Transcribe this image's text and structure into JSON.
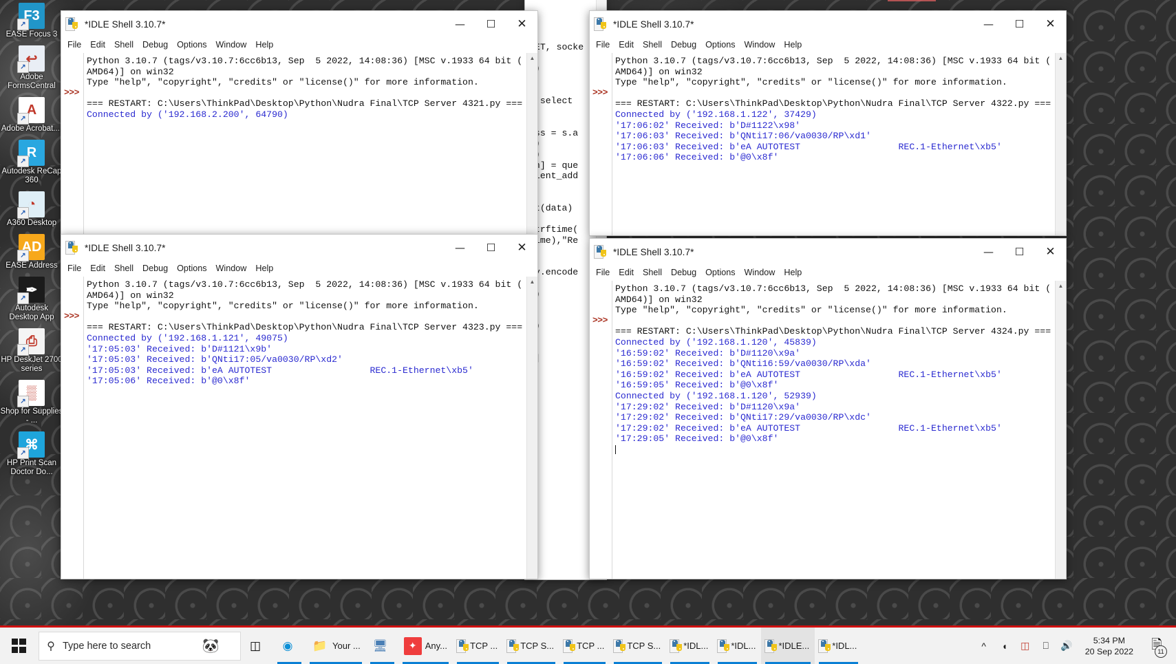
{
  "desktop": {
    "icons": [
      {
        "name": "EASE Focus 3",
        "label": "EASE Focus 3",
        "glyph": "F3",
        "bg": "#2196c9"
      },
      {
        "name": "Adobe FormsCentral",
        "label": "Adobe FormsCentral",
        "glyph": "↩",
        "bg": "#e9eef5"
      },
      {
        "name": "Adobe Acrobat",
        "label": "Adobe Acrobat....",
        "glyph": "A",
        "bg": "#ffffff"
      },
      {
        "name": "Autodesk ReCap 360",
        "label": "Autodesk ReCap 360",
        "glyph": "R",
        "bg": "#29a7e0"
      },
      {
        "name": "A360 Desktop",
        "label": "A360 Desktop",
        "glyph": "◔",
        "bg": "#dfeff7"
      },
      {
        "name": "EASE Address",
        "label": "EASE Address",
        "glyph": "AD",
        "bg": "#f7a81b"
      },
      {
        "name": "Autodesk Desktop App",
        "label": "Autodesk Desktop App",
        "glyph": "✒",
        "bg": "#1b1b1b"
      },
      {
        "name": "HP DeskJet 2700 series",
        "label": "HP DeskJet 2700 series",
        "glyph": "⎙",
        "bg": "#f4f4f4"
      },
      {
        "name": "Shop for Supplies",
        "label": "Shop for Supplies - ...",
        "glyph": "▒",
        "bg": "#ffffff"
      },
      {
        "name": "HP Print Scan Doctor",
        "label": "HP Print Scan Doctor Do...",
        "glyph": "⌘",
        "bg": "#1ea5dc"
      }
    ]
  },
  "window_common": {
    "title": "*IDLE Shell 3.10.7*",
    "icon": "python-file-icon",
    "menu": [
      "File",
      "Edit",
      "Shell",
      "Debug",
      "Options",
      "Window",
      "Help"
    ],
    "minimize": "—",
    "maximize": "☐",
    "close": "✕",
    "prompt": ">>>",
    "banner_line1": "Python 3.10.7 (tags/v3.10.7:6cc6b13, Sep  5 2022, 14:08:36) [MSC v.1933 64 bit (",
    "banner_line2": "AMD64)] on win32",
    "banner_line3": "Type \"help\", \"copyright\", \"credits\" or \"license()\" for more information."
  },
  "windows": [
    {
      "id": "shell-4321",
      "restart": "=== RESTART: C:\\Users\\ThinkPad\\Desktop\\Python\\Nudra Final\\TCP Server 4321.py ===",
      "lines": [
        {
          "text": "Connected by ('192.168.2.200', 64790)",
          "color": "blue"
        }
      ]
    },
    {
      "id": "shell-4322",
      "restart": "=== RESTART: C:\\Users\\ThinkPad\\Desktop\\Python\\Nudra Final\\TCP Server 4322.py ===",
      "lines": [
        {
          "text": "Connected by ('192.168.1.122', 37429)",
          "color": "blue"
        },
        {
          "text": "'17:06:02' Received: b'D#1122\\x98'",
          "color": "blue"
        },
        {
          "text": "'17:06:03' Received: b'QNti17:06/va0030/RP\\xd1'",
          "color": "blue"
        },
        {
          "text": "'17:06:03' Received: b'eA AUTOTEST                  REC.1-Ethernet\\xb5'",
          "color": "blue"
        },
        {
          "text": "'17:06:06' Received: b'@0\\x8f'",
          "color": "blue"
        }
      ]
    },
    {
      "id": "shell-4323",
      "restart": "=== RESTART: C:\\Users\\ThinkPad\\Desktop\\Python\\Nudra Final\\TCP Server 4323.py ===",
      "lines": [
        {
          "text": "Connected by ('192.168.1.121', 49075)",
          "color": "blue"
        },
        {
          "text": "'17:05:03' Received: b'D#1121\\x9b'",
          "color": "blue"
        },
        {
          "text": "'17:05:03' Received: b'QNti17:05/va0030/RP\\xd2'",
          "color": "blue"
        },
        {
          "text": "'17:05:03' Received: b'eA AUTOTEST                  REC.1-Ethernet\\xb5'",
          "color": "blue"
        },
        {
          "text": "'17:05:06' Received: b'@0\\x8f'",
          "color": "blue"
        }
      ]
    },
    {
      "id": "shell-4324",
      "restart": "=== RESTART: C:\\Users\\ThinkPad\\Desktop\\Python\\Nudra Final\\TCP Server 4324.py ===",
      "lines": [
        {
          "text": "Connected by ('192.168.1.120', 45839)",
          "color": "blue"
        },
        {
          "text": "'16:59:02' Received: b'D#1120\\x9a'",
          "color": "blue"
        },
        {
          "text": "'16:59:02' Received: b'QNti16:59/va0030/RP\\xda'",
          "color": "blue"
        },
        {
          "text": "'16:59:02' Received: b'eA AUTOTEST                  REC.1-Ethernet\\xb5'",
          "color": "blue"
        },
        {
          "text": "'16:59:05' Received: b'@0\\x8f'",
          "color": "blue"
        },
        {
          "text": "Connected by ('192.168.1.120', 52939)",
          "color": "blue"
        },
        {
          "text": "'17:29:02' Received: b'D#1120\\x9a'",
          "color": "blue"
        },
        {
          "text": "'17:29:02' Received: b'QNti17:29/va0030/RP\\xdc'",
          "color": "blue"
        },
        {
          "text": "'17:29:02' Received: b'eA AUTOTEST                  REC.1-Ethernet\\xb5'",
          "color": "blue"
        },
        {
          "text": "'17:29:05' Received: b'@0\\x8f'",
          "color": "blue"
        }
      ]
    }
  ],
  "background_editor": {
    "code": "NET, socke\n\n))\n\n\n= select\n\n\ness = s.a\n0)\nn)\non] = que\nlient_add\n\n\nut(data)\n)\nstrftime(\ntime),\"Re\n\n\nly.encode\n:\ns)\n\n\ns)\n\n\ns]"
  },
  "taskbar": {
    "search_placeholder": "Type here to search",
    "search_icon": "search-icon",
    "start_icon": "windows-logo-icon",
    "task_view_icon": "task-view-icon",
    "buttons": [
      {
        "name": "edge",
        "label": "",
        "icon": "edge-icon"
      },
      {
        "name": "file-explorer",
        "label": "Your ...",
        "icon": "folder-icon"
      },
      {
        "name": "remote-desktop",
        "label": "",
        "icon": "remote-desktop-icon"
      },
      {
        "name": "anydesk",
        "label": "Any...",
        "icon": "anydesk-icon"
      },
      {
        "name": "tcp-1",
        "label": "TCP ...",
        "icon": "python-file-icon"
      },
      {
        "name": "tcp-2",
        "label": "TCP S...",
        "icon": "python-file-icon"
      },
      {
        "name": "tcp-3",
        "label": "TCP ...",
        "icon": "python-file-icon"
      },
      {
        "name": "tcp-4",
        "label": "TCP S...",
        "icon": "python-file-icon"
      },
      {
        "name": "idle-1",
        "label": "*IDL...",
        "icon": "python-file-icon"
      },
      {
        "name": "idle-2",
        "label": "*IDL...",
        "icon": "python-file-icon"
      },
      {
        "name": "idle-3",
        "label": "*IDLE...",
        "icon": "python-file-icon"
      },
      {
        "name": "idle-4",
        "label": "*IDL...",
        "icon": "python-file-icon"
      }
    ],
    "tray": [
      {
        "name": "show-hidden-icons",
        "glyph": "⌃"
      },
      {
        "name": "camera-icon",
        "glyph": "⌀"
      },
      {
        "name": "battery-icon",
        "glyph": "▭"
      },
      {
        "name": "network-icon",
        "glyph": "⌸"
      },
      {
        "name": "volume-icon",
        "glyph": "⤩8"
      }
    ],
    "clock_time": "5:34 PM",
    "clock_date": "20 Sep 2022",
    "notification_icon": "notification-icon",
    "notification_count": "11"
  }
}
